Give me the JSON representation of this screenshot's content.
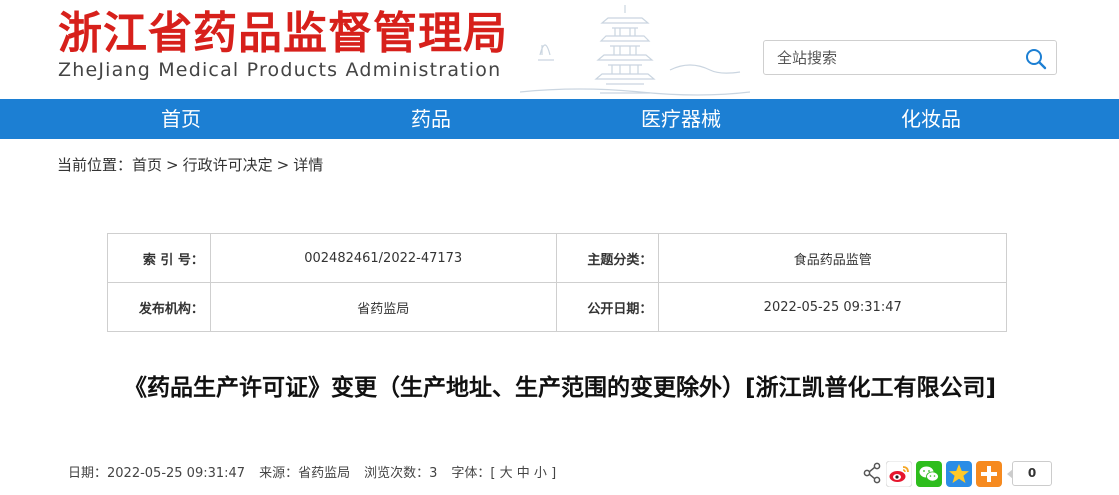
{
  "header": {
    "title_cn": "浙江省药品监督管理局",
    "title_en": "ZheJiang Medical Products Administration"
  },
  "search": {
    "placeholder": "全站搜索",
    "icon": "search-icon"
  },
  "nav": {
    "items": [
      {
        "label": "首页"
      },
      {
        "label": "药品"
      },
      {
        "label": "医疗器械"
      },
      {
        "label": "化妆品"
      }
    ]
  },
  "breadcrumb": {
    "prefix": "当前位置：",
    "items": [
      "首页",
      "行政许可决定",
      "详情"
    ],
    "separator": ">"
  },
  "info": {
    "index_label": "索 引 号：",
    "index_value": "002482461/2022-47173",
    "topic_label": "主题分类：",
    "topic_value": "食品药品监管",
    "publisher_label": "发布机构：",
    "publisher_value": "省药监局",
    "date_label": "公开日期：",
    "date_value": "2022-05-25 09:31:47"
  },
  "article": {
    "title": "《药品生产许可证》变更（生产地址、生产范围的变更除外）[浙江凯普化工有限公司]"
  },
  "meta": {
    "date": "日期：2022-05-25 09:31:47",
    "source": "来源：省药监局",
    "views": "浏览次数：3",
    "font_label": "字体：[",
    "font_large": "大",
    "font_medium": "中",
    "font_small": "小",
    "font_close": "]"
  },
  "share": {
    "icons": [
      "share-icon",
      "weibo-icon",
      "wechat-icon",
      "qzone-icon",
      "more-icon"
    ],
    "count": "0"
  },
  "colors": {
    "brand_red": "#d7201b",
    "nav_blue": "#1c7fd3"
  }
}
